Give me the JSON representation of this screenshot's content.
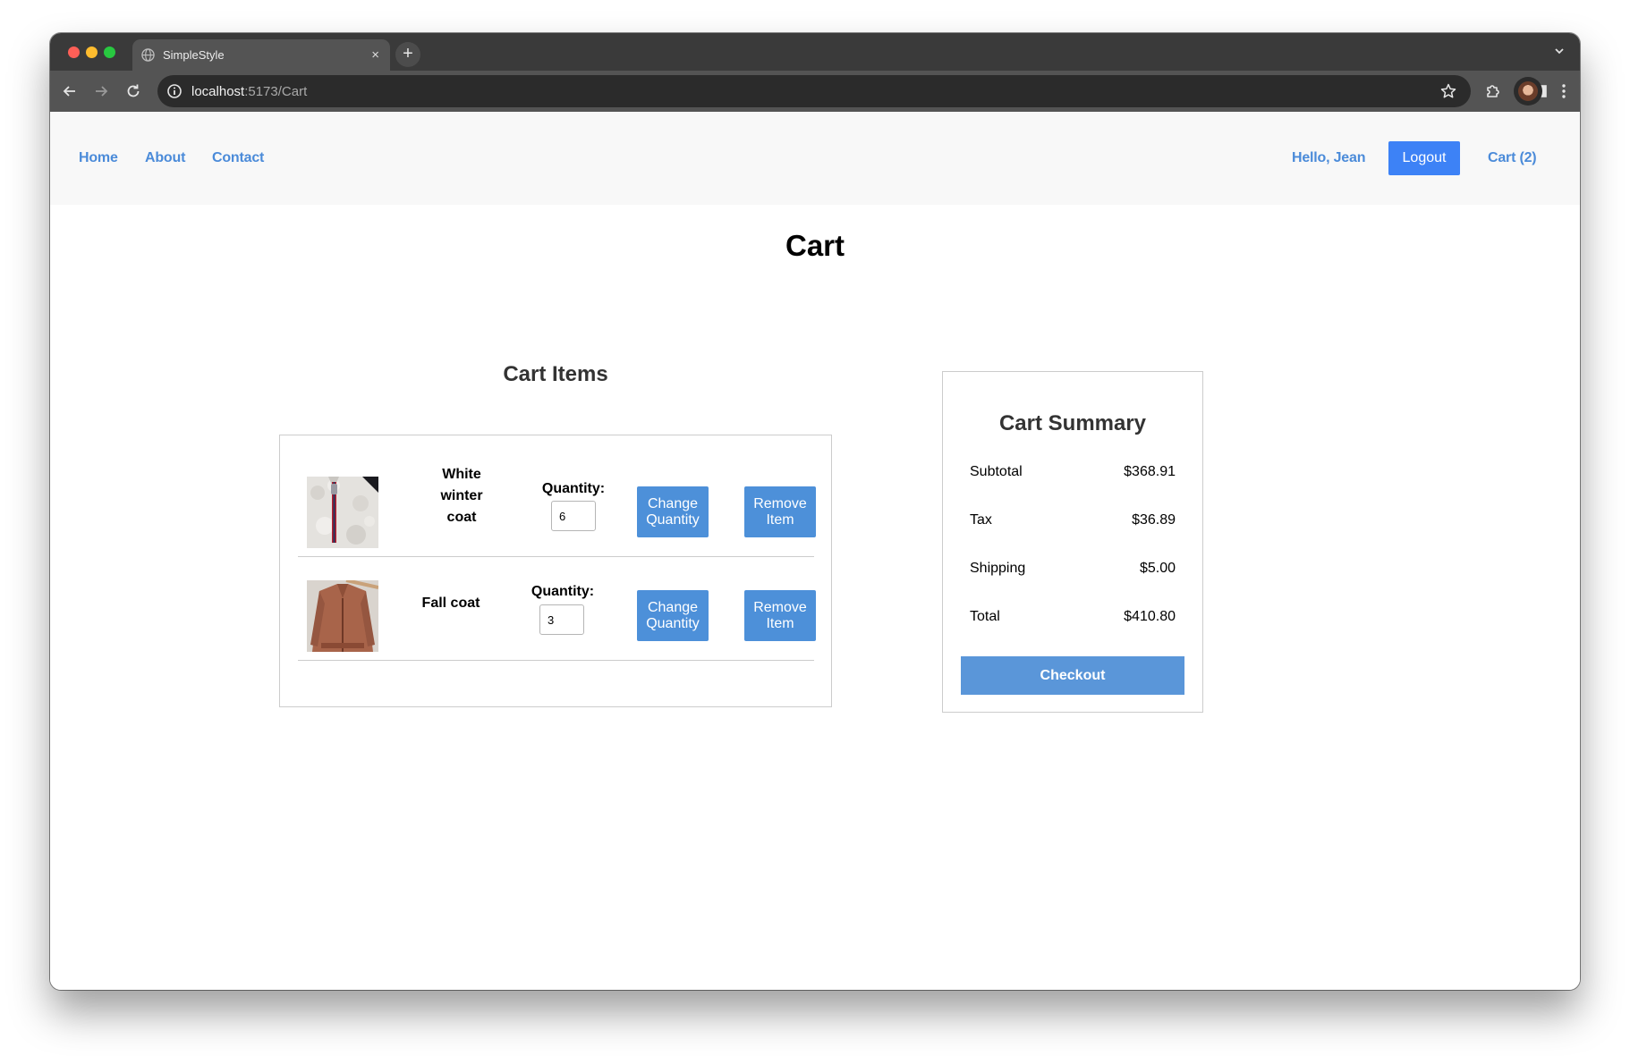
{
  "browser": {
    "tab_title": "SimpleStyle",
    "tab_close": "×",
    "new_tab": "+",
    "url_host": "localhost",
    "url_path": ":5173/Cart"
  },
  "navbar": {
    "links": [
      "Home",
      "About",
      "Contact"
    ],
    "greeting": "Hello, Jean",
    "logout_label": "Logout",
    "cart_link": "Cart (2)",
    "link_color": "#4b8bd9",
    "logout_color": "#3d82f6"
  },
  "page": {
    "title": "Cart"
  },
  "cart_items": {
    "heading": "Cart Items",
    "quantity_label": "Quantity:",
    "change_label": "Change Quantity",
    "remove_label": "Remove Item",
    "items": [
      {
        "name": "White winter coat",
        "quantity": "6",
        "image": "white-fleece-coat-photo"
      },
      {
        "name": "Fall coat",
        "quantity": "3",
        "image": "brown-suede-jacket-photo"
      }
    ]
  },
  "summary": {
    "heading": "Cart Summary",
    "rows": [
      {
        "label": "Subtotal",
        "value": "$368.91"
      },
      {
        "label": "Tax",
        "value": "$36.89"
      },
      {
        "label": "Shipping",
        "value": "$5.00"
      },
      {
        "label": "Total",
        "value": "$410.80"
      }
    ],
    "checkout_label": "Checkout",
    "button_color": "#5a96d9"
  }
}
